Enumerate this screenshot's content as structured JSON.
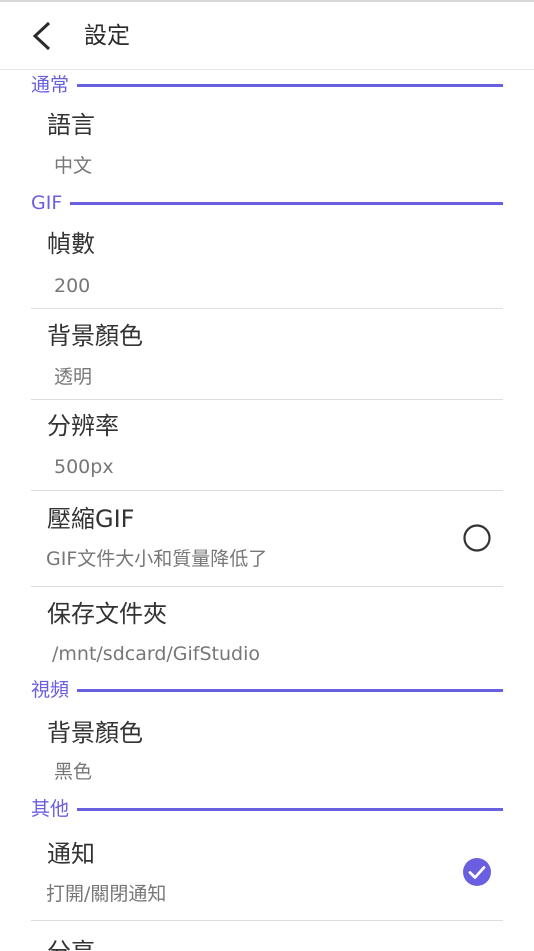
{
  "app_bar": {
    "title": "設定"
  },
  "sections": {
    "general": {
      "header": "通常",
      "language": {
        "title": "語言",
        "summary": "中文"
      }
    },
    "gif": {
      "header": "GIF",
      "frame_count": {
        "title": "幀數",
        "summary": "200"
      },
      "background_color": {
        "title": "背景顏色",
        "summary": "透明"
      },
      "resolution": {
        "title": "分辨率",
        "summary": "500px"
      },
      "compress": {
        "title": "壓縮GIF",
        "summary": "GIF文件大小和質量降低了",
        "checked": false
      },
      "save_folder": {
        "title": "保存文件夾",
        "summary": "/mnt/sdcard/GifStudio"
      }
    },
    "video": {
      "header": "視頻",
      "background_color": {
        "title": "背景顏色",
        "summary": "黑色"
      }
    },
    "other": {
      "header": "其他",
      "notification": {
        "title": "通知",
        "summary": "打開/關閉通知",
        "checked": true
      },
      "next_item_partial": {
        "title": "分享"
      }
    }
  },
  "colors": {
    "accent": "#6a5fe0",
    "title_text": "#333333",
    "summary_text": "#777777",
    "divider": "#dedede"
  }
}
